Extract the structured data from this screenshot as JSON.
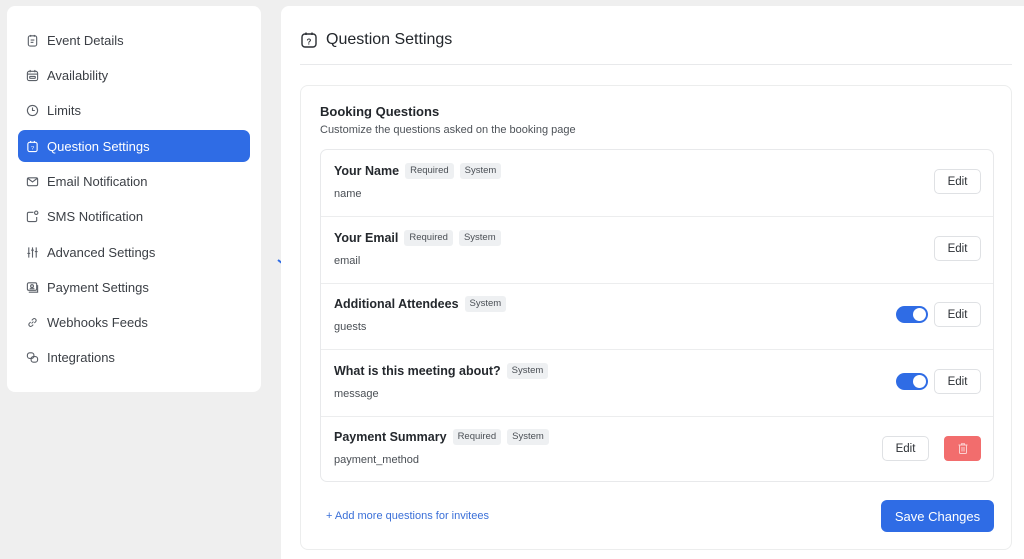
{
  "sidebar": {
    "items": [
      {
        "label": "Event Details",
        "icon": "clipboard-icon",
        "active": false
      },
      {
        "label": "Availability",
        "icon": "calendar-icon",
        "active": false
      },
      {
        "label": "Limits",
        "icon": "clock-icon",
        "active": false
      },
      {
        "label": "Question Settings",
        "icon": "question-calendar-icon",
        "active": true
      },
      {
        "label": "Email Notification",
        "icon": "envelope-icon",
        "active": false
      },
      {
        "label": "SMS Notification",
        "icon": "sms-icon",
        "active": false
      },
      {
        "label": "Advanced Settings",
        "icon": "sliders-icon",
        "active": false
      },
      {
        "label": "Payment Settings",
        "icon": "payment-icon",
        "active": false
      },
      {
        "label": "Webhooks Feeds",
        "icon": "link-icon",
        "active": false
      },
      {
        "label": "Integrations",
        "icon": "integrations-icon",
        "active": false
      }
    ]
  },
  "header": {
    "title": "Question Settings",
    "icon": "question-calendar-icon"
  },
  "booking": {
    "title": "Booking Questions",
    "subtitle": "Customize the questions asked on the booking page",
    "questions": [
      {
        "title": "Your Name",
        "badges": [
          "Required",
          "System"
        ],
        "key": "name",
        "toggle": null,
        "edit_label": "Edit",
        "deletable": false
      },
      {
        "title": "Your Email",
        "badges": [
          "Required",
          "System"
        ],
        "key": "email",
        "toggle": null,
        "edit_label": "Edit",
        "deletable": false
      },
      {
        "title": "Additional Attendees",
        "badges": [
          "System"
        ],
        "key": "guests",
        "toggle": true,
        "edit_label": "Edit",
        "deletable": false
      },
      {
        "title": "What is this meeting about?",
        "badges": [
          "System"
        ],
        "key": "message",
        "toggle": true,
        "edit_label": "Edit",
        "deletable": false
      },
      {
        "title": "Payment Summary",
        "badges": [
          "Required",
          "System"
        ],
        "key": "payment_method",
        "toggle": null,
        "edit_label": "Edit",
        "deletable": true
      }
    ],
    "add_link": "+ Add more questions for invitees",
    "save_label": "Save Changes"
  },
  "colors": {
    "accent": "#2f6ce5",
    "danger": "#f26d6d",
    "link": "#3a6fd8"
  }
}
